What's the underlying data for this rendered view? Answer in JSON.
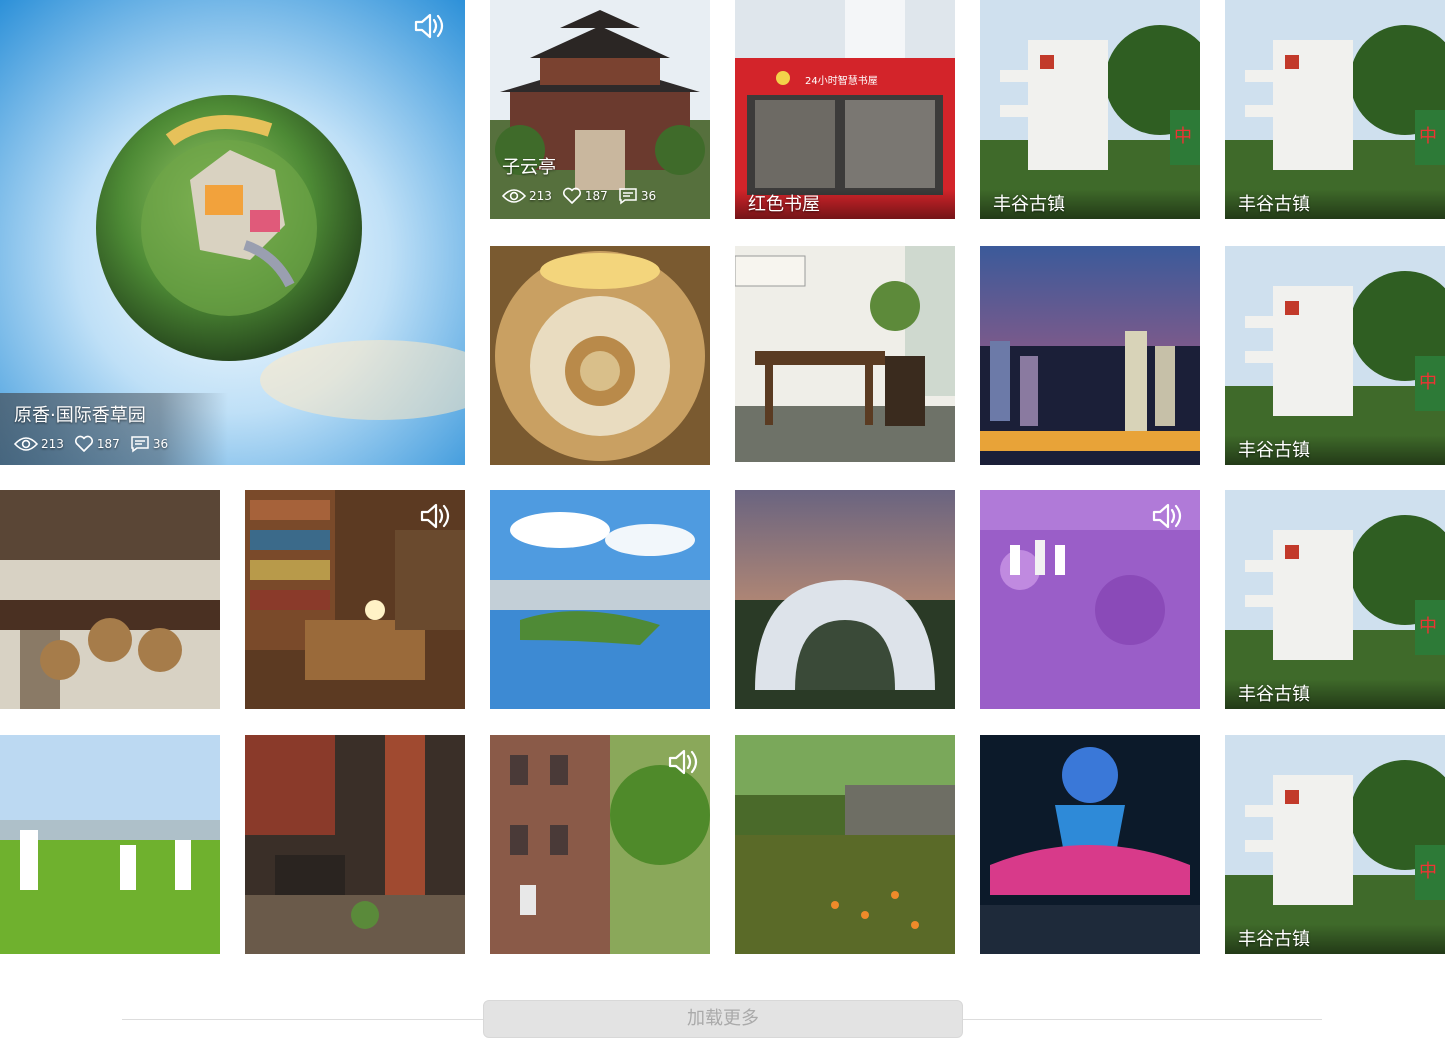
{
  "featured": {
    "title": "原香·国际香草园",
    "views": "213",
    "likes": "187",
    "comments": "36"
  },
  "tiles": [
    {
      "title": "子云亭",
      "views": "213",
      "likes": "187",
      "comments": "36"
    },
    {
      "title": "红色书屋"
    },
    {
      "title": "丰谷古镇"
    },
    {
      "title": "丰谷古镇"
    },
    {
      "title": "丰谷古镇"
    },
    {
      "title": "丰谷古镇"
    },
    {
      "title": "丰谷古镇"
    }
  ],
  "load_more": {
    "label": "加载更多"
  },
  "icons": {
    "audio": "speaker-icon",
    "views": "eye-icon",
    "likes": "heart-icon",
    "comments": "comment-icon"
  }
}
